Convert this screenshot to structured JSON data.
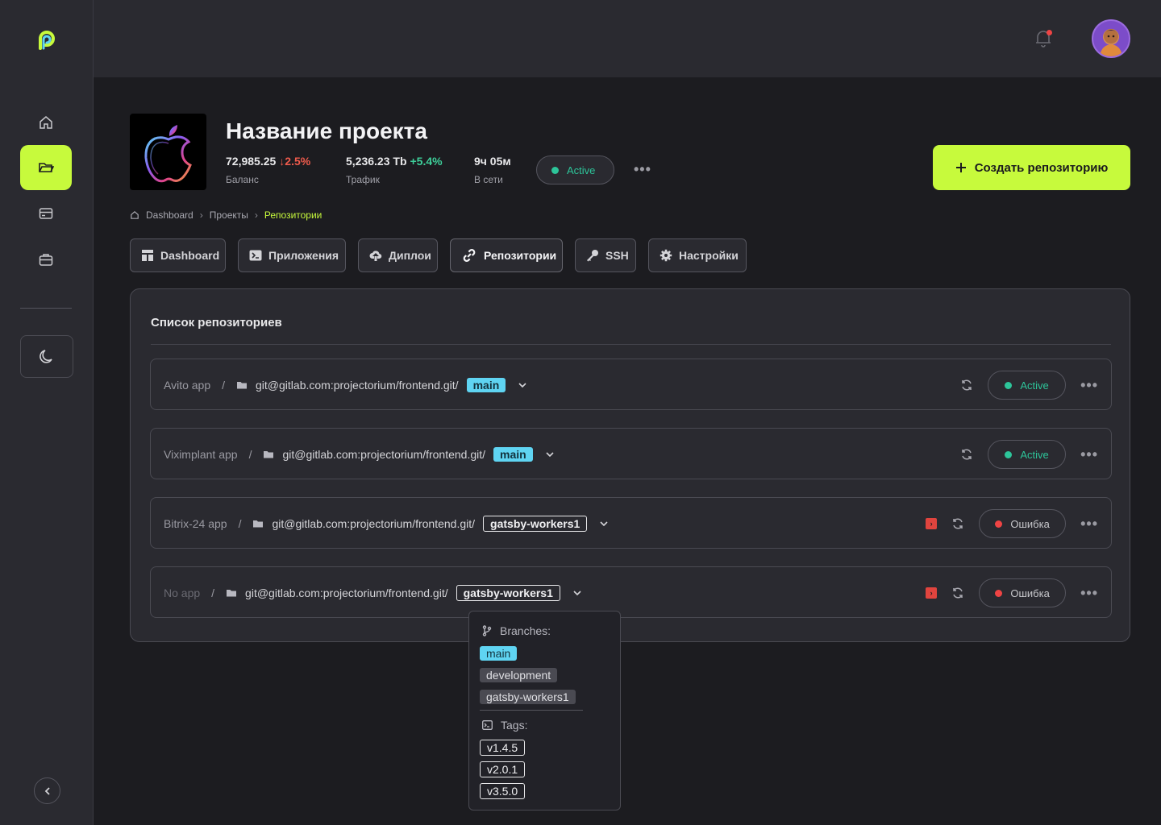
{
  "project": {
    "title": "Название проекта",
    "balance_value": "72,985.25",
    "balance_delta": "↓2.5%",
    "balance_label": "Баланс",
    "traffic_value": "5,236.23 Tb",
    "traffic_delta": "+5.4%",
    "traffic_label": "Трафик",
    "online_value": "9ч 05м",
    "online_label": "В сети",
    "status": "Active",
    "create_label": "Создать репозиторию"
  },
  "breadcrumb": {
    "items": [
      "Dashboard",
      "Проекты",
      "Репозитории"
    ]
  },
  "tabs": [
    {
      "label": "Dashboard",
      "icon": "dashboard-icon"
    },
    {
      "label": "Приложения",
      "icon": "terminal-icon"
    },
    {
      "label": "Диплои",
      "icon": "cloud-upload-icon"
    },
    {
      "label": "Репозитории",
      "icon": "link-icon"
    },
    {
      "label": "SSH",
      "icon": "key-icon"
    },
    {
      "label": "Настройки",
      "icon": "gear-icon"
    }
  ],
  "repo_list": {
    "title": "Список репозиториев",
    "rows": [
      {
        "app": "Avito app",
        "url": "git@gitlab.com:projectorium/frontend.git/",
        "branch": "main",
        "status": "Active"
      },
      {
        "app": "Viximplant app",
        "url": "git@gitlab.com:projectorium/frontend.git/",
        "branch": "main",
        "status": "Active"
      },
      {
        "app": "Bitrix-24 app",
        "url": "git@gitlab.com:projectorium/frontend.git/",
        "branch": "gatsby-workers1",
        "status": "Ошибка"
      },
      {
        "app": "No app",
        "url": "git@gitlab.com:projectorium/frontend.git/",
        "branch": "gatsby-workers1",
        "status": "Ошибка"
      }
    ],
    "separator": "/"
  },
  "dropdown": {
    "branches_label": "Branches:",
    "branches": [
      "main",
      "development",
      "gatsby-workers1"
    ],
    "tags_label": "Tags:",
    "tags": [
      "v1.4.5",
      "v2.0.1",
      "v3.5.0"
    ]
  },
  "colors": {
    "accent": "#c7fa3c",
    "active": "#2dc59a",
    "error": "#ef4444",
    "branch": "#5fd4f2"
  }
}
